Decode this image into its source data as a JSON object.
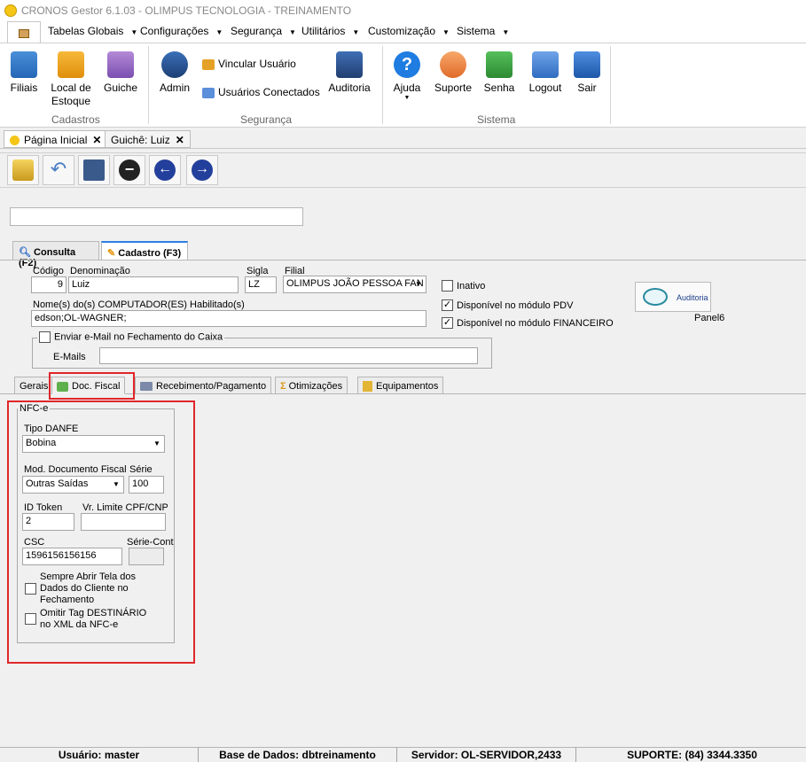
{
  "window": {
    "title": "CRONOS Gestor 6.1.03 - OLIMPUS TECNOLOGIA - TREINAMENTO"
  },
  "menu": {
    "items": [
      {
        "label": "Tabelas Globais"
      },
      {
        "label": "Configurações"
      },
      {
        "label": "Segurança"
      },
      {
        "label": "Utilitários"
      },
      {
        "label": "Customização"
      },
      {
        "label": "Sistema"
      }
    ]
  },
  "ribbon": {
    "cadastros": {
      "title": "Cadastros",
      "filiais": "Filiais",
      "local_line1": "Local de",
      "local_line2": "Estoque",
      "guiche": "Guiche"
    },
    "seguranca": {
      "title": "Segurança",
      "admin": "Admin",
      "vincular": "Vincular Usuário",
      "conectados": "Usuários Conectados",
      "auditoria": "Auditoria"
    },
    "sistema": {
      "title": "Sistema",
      "ajuda": "Ajuda",
      "suporte": "Suporte",
      "senha": "Senha",
      "logout": "Logout",
      "sair": "Sair"
    }
  },
  "doc_tabs": {
    "home": "Página Inicial",
    "guiche": "Guichê: Luiz"
  },
  "page_tabs": {
    "consulta": "Consulta (F2)",
    "cadastro": "Cadastro (F3)"
  },
  "form": {
    "codigo_label": "Código",
    "codigo_value": "9",
    "denominacao_label": "Denominação",
    "denominacao_value": "Luiz",
    "sigla_label": "Sigla",
    "sigla_value": "LZ",
    "filial_label": "Filial",
    "filial_value": "OLIMPUS JOÃO PESSOA FAN",
    "inativo_label": "Inativo",
    "pdv_label": "Disponível no módulo PDV",
    "financeiro_label": "Disponível no módulo FINANCEIRO",
    "computadores_label": "Nome(s) do(s) COMPUTADOR(ES) Habilitado(s)",
    "computadores_value": "edson;OL-WAGNER;",
    "email_group_label": "Enviar e-Mail no Fechamento do Caixa",
    "emails_label": "E-Mails",
    "emails_value": "",
    "auditoria_label": "Auditoria",
    "panel6_label": "Panel6"
  },
  "bottom_tabs": {
    "gerais": "Gerais",
    "doc_fiscal": "Doc. Fiscal",
    "recebimento": "Recebimento/Pagamento",
    "otimizacoes": "Otimizações",
    "equipamentos": "Equipamentos"
  },
  "nfce": {
    "legend": "NFC-e",
    "tipo_danfe_label": "Tipo DANFE",
    "tipo_danfe_value": "Bobina",
    "mod_label": "Mod. Documento Fiscal",
    "mod_value": "Outras Saídas",
    "serie_label": "Série",
    "serie_value": "100",
    "id_token_label": "ID Token",
    "id_token_value": "2",
    "vr_limite_label": "Vr. Limite CPF/CNPJ",
    "vr_limite_value": "",
    "csc_label": "CSC",
    "csc_value": "1596156156156",
    "serie_cont_label": "Série-Cont",
    "serie_cont_value": "",
    "sempre_abrir_l1": "Sempre Abrir Tela dos",
    "sempre_abrir_l2": "Dados do Cliente no",
    "sempre_abrir_l3": "Fechamento",
    "omitir_l1": "Omitir Tag DESTINÁRIO",
    "omitir_l2": "no XML da NFC-e"
  },
  "status": {
    "usuario": "Usuário: master",
    "base": "Base de Dados: dbtreinamento",
    "servidor": "Servidor: OL-SERVIDOR,2433",
    "suporte": "SUPORTE: (84) 3344.3350"
  },
  "colors": {
    "accent": "#2e7de1",
    "highlight": "#e0262a"
  }
}
